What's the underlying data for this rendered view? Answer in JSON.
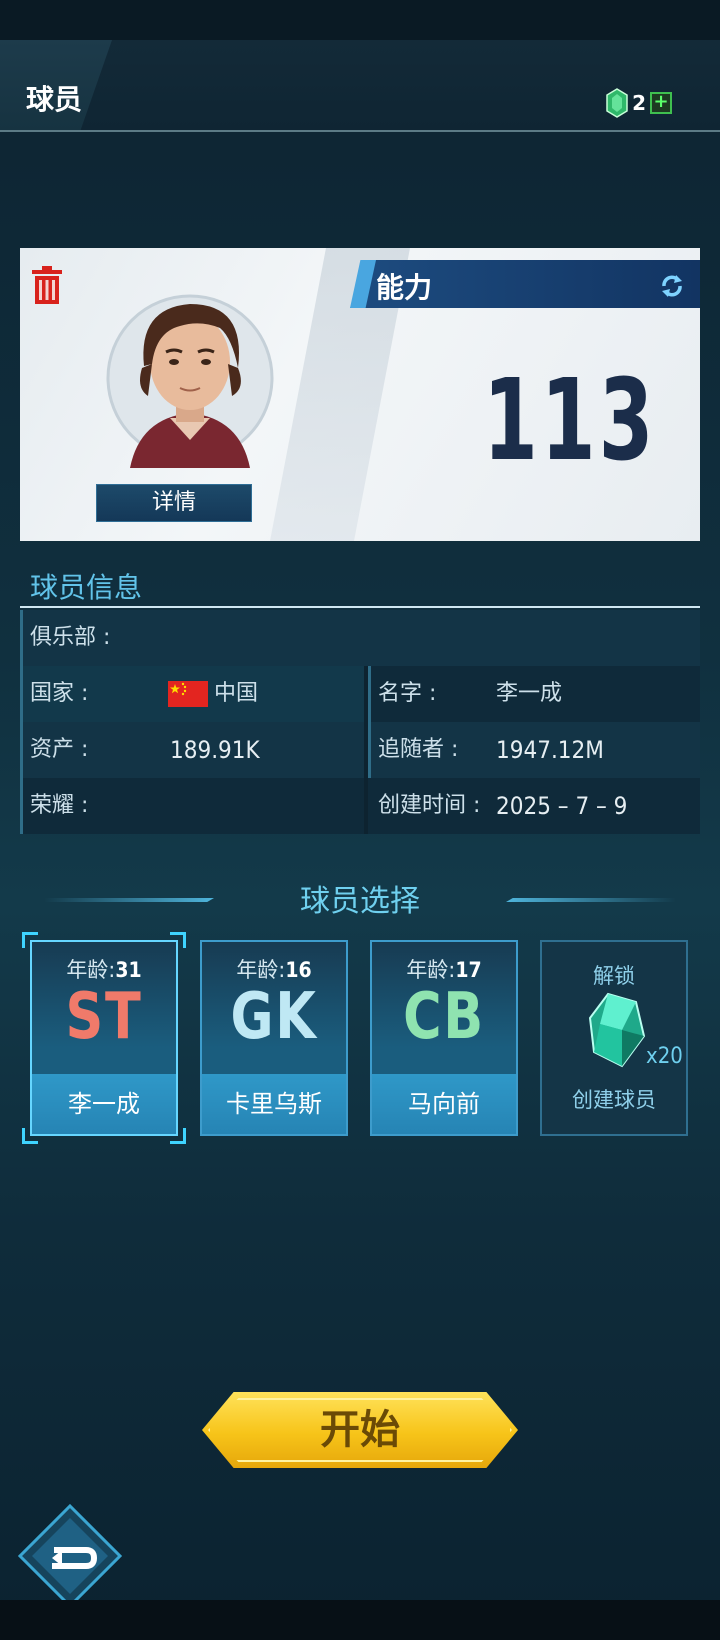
{
  "header": {
    "title": "球员",
    "gem_count": "2",
    "plus_label": "+"
  },
  "player_card": {
    "detail_label": "详情",
    "ability_label": "能力",
    "ability_value": "113"
  },
  "info": {
    "title": "球员信息",
    "club_label": "俱乐部 :",
    "club_value": "",
    "country_label": "国家 :",
    "country_value": "中国",
    "name_label": "名字 :",
    "name_value": "李一成",
    "assets_label": "资产 :",
    "assets_value": "189.91K",
    "followers_label": "追随者 :",
    "followers_value": "1947.12M",
    "honor_label": "荣耀 :",
    "honor_value": "",
    "created_label": "创建时间 :",
    "created_value": "2025 – 7 – 9"
  },
  "selection": {
    "title": "球员选择",
    "players": [
      {
        "age_label": "年龄:",
        "age": "31",
        "position": "ST",
        "name": "李一成",
        "pos_color": "#f07a6a",
        "selected": true
      },
      {
        "age_label": "年龄:",
        "age": "16",
        "position": "GK",
        "name": "卡里乌斯",
        "pos_color": "#bfe8f4",
        "selected": false
      },
      {
        "age_label": "年龄:",
        "age": "17",
        "position": "CB",
        "name": "马向前",
        "pos_color": "#8fe3b0",
        "selected": false
      }
    ],
    "unlock": {
      "label": "解锁",
      "cost": "x20",
      "create_label": "创建球员"
    }
  },
  "start_label": "开始",
  "icons": {
    "trash": "trash-icon",
    "refresh": "refresh-icon",
    "gem": "gem-icon",
    "back": "back-icon"
  },
  "colors": {
    "accent": "#62c4ea",
    "start": "#f7c419",
    "ability_text": "#1b2d4a"
  }
}
